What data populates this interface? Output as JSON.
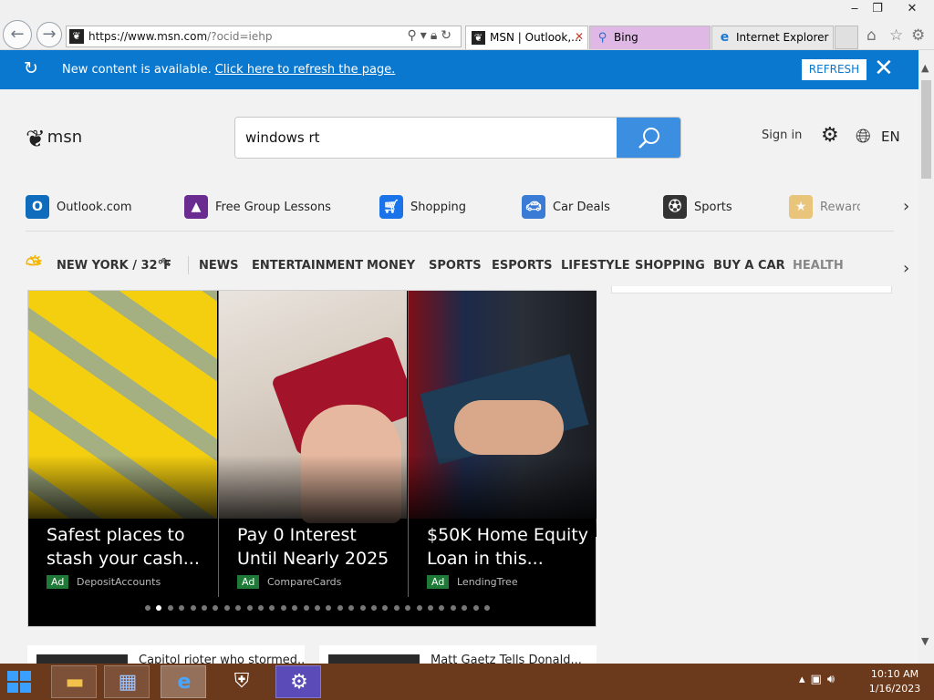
{
  "window": {
    "minimize": "‒",
    "restore": "❐",
    "close": "✕"
  },
  "browser": {
    "back_glyph": "←",
    "forward_glyph": "→",
    "url_host": "https://www.msn.com",
    "url_path": "/?ocid=iehp",
    "tabs": [
      {
        "title": "MSN | Outlook,...",
        "icon": "msn-icon"
      },
      {
        "title": "Bing",
        "icon": "search-icon"
      },
      {
        "title": "Internet Explorer is...",
        "icon": "ie-icon"
      }
    ],
    "toolbar_icons": [
      "home-icon",
      "favorites-icon",
      "settings-icon"
    ]
  },
  "notification": {
    "message": "New content is available.",
    "link": "Click here to refresh the page.",
    "refresh_label": "REFRESH"
  },
  "header": {
    "logo_text": "msn",
    "search_value": "windows rt",
    "sign_in": "Sign in",
    "language": "EN"
  },
  "quick_links": [
    {
      "label": "Outlook.com",
      "icon": "outlook-icon",
      "color": "#0f6cbd"
    },
    {
      "label": "Free Group Lessons",
      "icon": "graduation-cap-icon",
      "color": "#6a2c91"
    },
    {
      "label": "Shopping",
      "icon": "cart-icon",
      "color": "#1a73e8"
    },
    {
      "label": "Car Deals",
      "icon": "car-icon",
      "color": "#3a7bd5"
    },
    {
      "label": "Sports",
      "icon": "soccer-ball-icon",
      "color": "#333333"
    },
    {
      "label": "Rewards",
      "icon": "medal-icon",
      "color": "#e3a21a"
    }
  ],
  "categories": {
    "weather": "NEW YORK / 32°F",
    "items": [
      "NEWS",
      "ENTERTAINMENT",
      "MONEY",
      "SPORTS",
      "ESPORTS",
      "LIFESTYLE",
      "SHOPPING",
      "BUY A CAR",
      "HEALTH"
    ]
  },
  "carousel": {
    "cards": [
      {
        "title": "Safest places to stash your cash...",
        "badge": "Ad",
        "source": "DepositAccounts"
      },
      {
        "title": "Pay 0 Interest Until Nearly 2025",
        "badge": "Ad",
        "source": "CompareCards"
      },
      {
        "title": "$50K Home Equity Loan in this...",
        "badge": "Ad",
        "source": "LendingTree"
      }
    ],
    "dot_count": 31,
    "active_dot": 1
  },
  "news": [
    {
      "title": "Capitol rioter who stormed..."
    },
    {
      "title": "Matt Gaetz Tells Donald..."
    }
  ],
  "taskbar": {
    "apps": [
      "file-explorer-icon",
      "server-manager-icon",
      "internet-explorer-icon",
      "security-shield-icon",
      "settings-icon"
    ],
    "time": "10:10 AM",
    "date": "1/16/2023"
  },
  "colors": {
    "notify_bar": "#0a78cf",
    "search_button": "#3b8ee0",
    "taskbar": "#6b3a1c",
    "ad_badge": "#1f7a38"
  }
}
